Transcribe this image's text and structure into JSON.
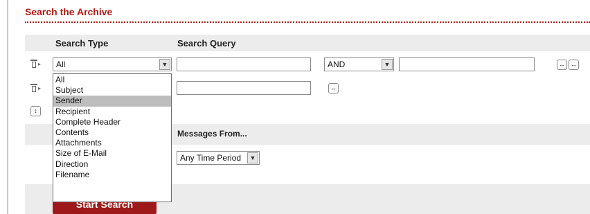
{
  "title": "Search the Archive",
  "headers": {
    "search_type": "Search Type",
    "search_query": "Search Query",
    "messages_from": "Messages From..."
  },
  "row1": {
    "type_selected": "All",
    "operator_selected": "AND",
    "query_value": "",
    "query2_value": ""
  },
  "row2": {
    "query_value": ""
  },
  "search_type_options": [
    "All",
    "Subject",
    "Sender",
    "Recipient",
    "Complete Header",
    "Contents",
    "Attachments",
    "Size of E-Mail",
    "Direction",
    "Filename"
  ],
  "highlighted_option": "Sender",
  "time_period_selected": "Any Time Period",
  "start_button_label": "Start Search",
  "icons": {
    "trash": "trash-icon",
    "dropdown": "dropdown-arrow-icon",
    "remove_row": "remove-row-icon",
    "add_row": "add-row-icon",
    "sort": "sort-icon"
  },
  "colors": {
    "accent": "#b31a14",
    "button": "#9e1a1a",
    "band": "#ececec",
    "selected": "#bdbdbd"
  }
}
